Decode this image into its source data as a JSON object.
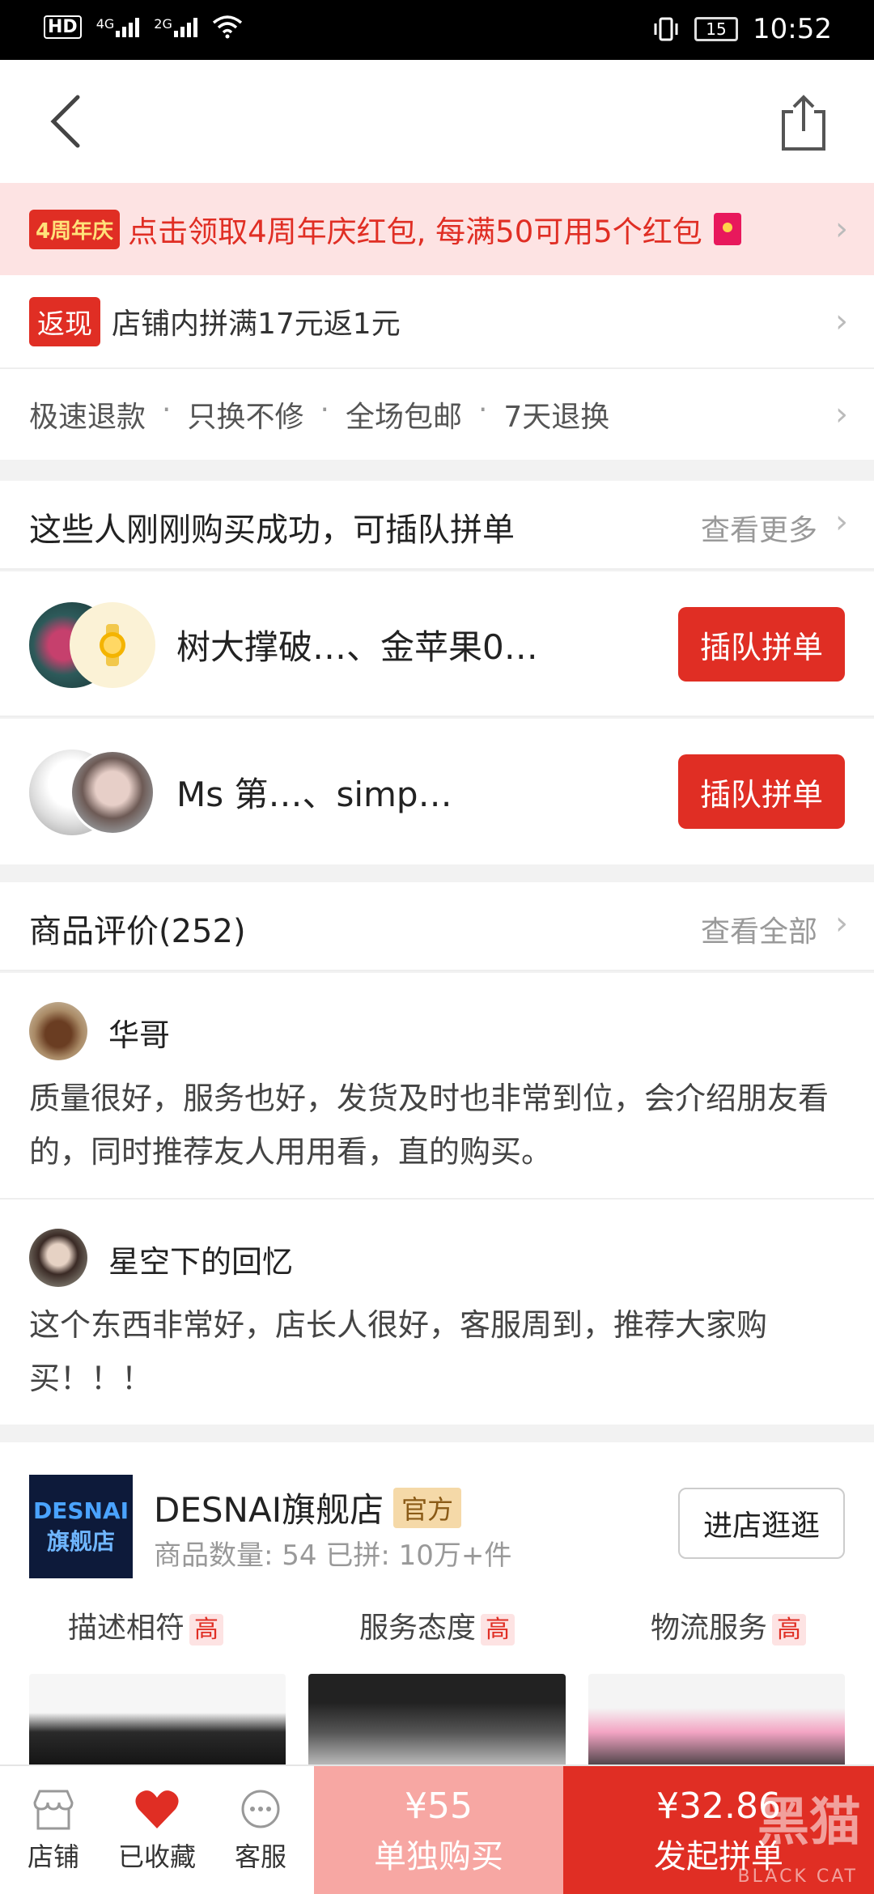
{
  "status_bar": {
    "left_icons": [
      "hd-icon",
      "signal-4g-icon",
      "signal-2g-icon",
      "wifi-icon"
    ],
    "net_4g": "4G",
    "net_2g": "2G",
    "hd": "HD",
    "battery": "15",
    "time": "10:52"
  },
  "nav": {
    "back_icon": "back-arrow-icon",
    "share_icon": "share-icon"
  },
  "promo": {
    "badge": "4周年庆",
    "text": "点击领取4周年庆红包, 每满50可用5个红包"
  },
  "cashback": {
    "badge": "返现",
    "text": "店铺内拼满17元返1元"
  },
  "services": [
    "极速退款",
    "只换不修",
    "全场包邮",
    "7天退换"
  ],
  "group_buy": {
    "title": "这些人刚刚购买成功，可插队拼单",
    "more": "查看更多",
    "rows": [
      {
        "names": "树大撑破…、金苹果0…",
        "button": "插队拼单"
      },
      {
        "names": "Ms 第…、simp…",
        "button": "插队拼单"
      }
    ]
  },
  "reviews": {
    "title": "商品评价(252)",
    "more": "查看全部",
    "items": [
      {
        "name": "华哥",
        "text": "质量很好，服务也好，发货及时也非常到位，会介绍朋友看的，同时推荐友人用用看，直的购买。"
      },
      {
        "name": "星空下的回忆",
        "text": "这个东西非常好，店长人很好，客服周到，推荐大家购买！！！"
      }
    ]
  },
  "store": {
    "logo_line1": "DESNAI",
    "logo_line2": "旗舰店",
    "name": "DESNAI旗舰店",
    "official": "官方",
    "stats": "商品数量: 54   已拼: 10万+件",
    "visit": "进店逛逛",
    "ratings": [
      {
        "label": "描述相符",
        "level": "高"
      },
      {
        "label": "服务态度",
        "level": "高"
      },
      {
        "label": "物流服务",
        "level": "高"
      }
    ]
  },
  "bottom": {
    "tabs": [
      {
        "label": "店铺",
        "icon": "store-icon"
      },
      {
        "label": "已收藏",
        "icon": "heart-icon"
      },
      {
        "label": "客服",
        "icon": "chat-icon"
      }
    ],
    "solo_price": "¥55",
    "solo_label": "单独购买",
    "group_price": "¥32.86",
    "group_label": "发起拼单",
    "watermark": "黑猫",
    "watermark_sub": "BLACK CAT"
  },
  "colors": {
    "brand_red": "#e02e24",
    "light_red": "#f7a7a3",
    "promo_bg": "#fde3e3"
  }
}
